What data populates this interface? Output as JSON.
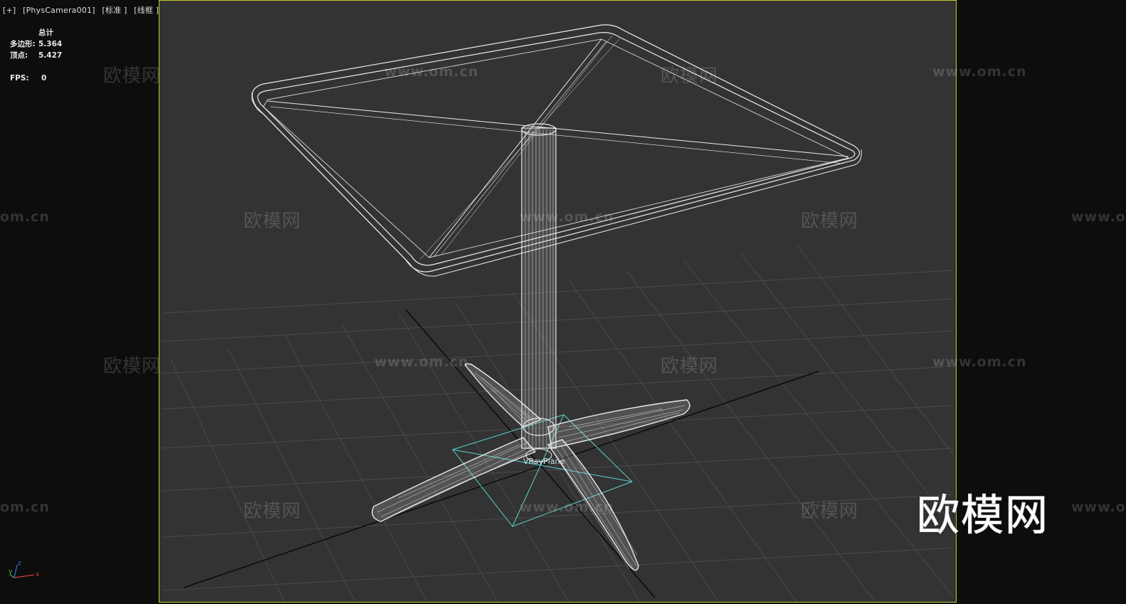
{
  "viewport": {
    "plus_menu": "[+]",
    "camera_menu": "[PhysCamera001]",
    "shading_std": "[标准 ]",
    "shading_mode": "[线框 ]"
  },
  "stats": {
    "header": "总计",
    "polys_label": "多边形:",
    "polys_value": "5.364",
    "verts_label": "顶点:",
    "verts_value": "5.427",
    "fps_label": "FPS:",
    "fps_value": "0"
  },
  "gizmo_label": "VRayPlane",
  "axis": {
    "x": "x",
    "y": "y",
    "z": "z"
  },
  "watermarks": {
    "brand_cn": "欧模网",
    "brand_url": "www.om.cn",
    "url_cut_left": "om.cn",
    "url_cut_right": "www.o"
  },
  "logo_text": "欧模网",
  "colors": {
    "viewport_bg": "#333333",
    "frame_border": "#c8c832",
    "wire": "#ececec",
    "gizmo": "#5ad2d2",
    "grid": "#4a4a4a"
  }
}
